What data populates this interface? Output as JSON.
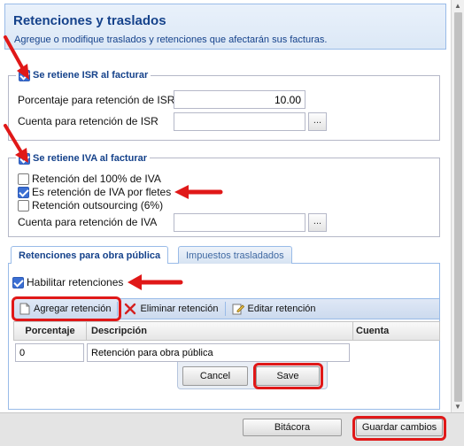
{
  "header": {
    "title": "Retenciones y traslados",
    "description": "Agregue o modifique traslados y retenciones que afectarán sus facturas."
  },
  "isr": {
    "legend": "Se retiene ISR al facturar",
    "checked": true,
    "percentage_label": "Porcentaje para retención de ISR:",
    "percentage_value": "10.00",
    "account_label": "Cuenta para retención de ISR",
    "account_value": "",
    "browse_label": "..."
  },
  "iva": {
    "legend": "Se retiene IVA al facturar",
    "checked": true,
    "options": [
      {
        "label": "Retención del 100% de IVA",
        "checked": false
      },
      {
        "label": "Es retención de IVA por fletes",
        "checked": true
      },
      {
        "label": "Retención outsourcing (6%)",
        "checked": false
      }
    ],
    "account_label": "Cuenta para retención de IVA",
    "account_value": "",
    "browse_label": "..."
  },
  "tabs": [
    {
      "label": "Retenciones para obra pública",
      "active": true
    },
    {
      "label": "Impuestos trasladados",
      "active": false
    }
  ],
  "obra_publica": {
    "enable_label": "Habilitar retenciones",
    "enable_checked": true,
    "toolbar": {
      "add_label": "Agregar retención",
      "delete_label": "Eliminar retención",
      "edit_label": "Editar retención"
    },
    "grid": {
      "columns": [
        "Porcentaje",
        "Descripción",
        "Cuenta"
      ],
      "editing_row": {
        "percentage": "0",
        "description": "Retención para obra pública",
        "account": ""
      }
    },
    "cancel_label": "Cancel",
    "save_label": "Save"
  },
  "footer": {
    "log_label": "Bitácora",
    "save_changes_label": "Guardar cambios"
  },
  "colors": {
    "accent": "#15428b",
    "highlight": "#e01818",
    "panel_border": "#99bbe8"
  }
}
